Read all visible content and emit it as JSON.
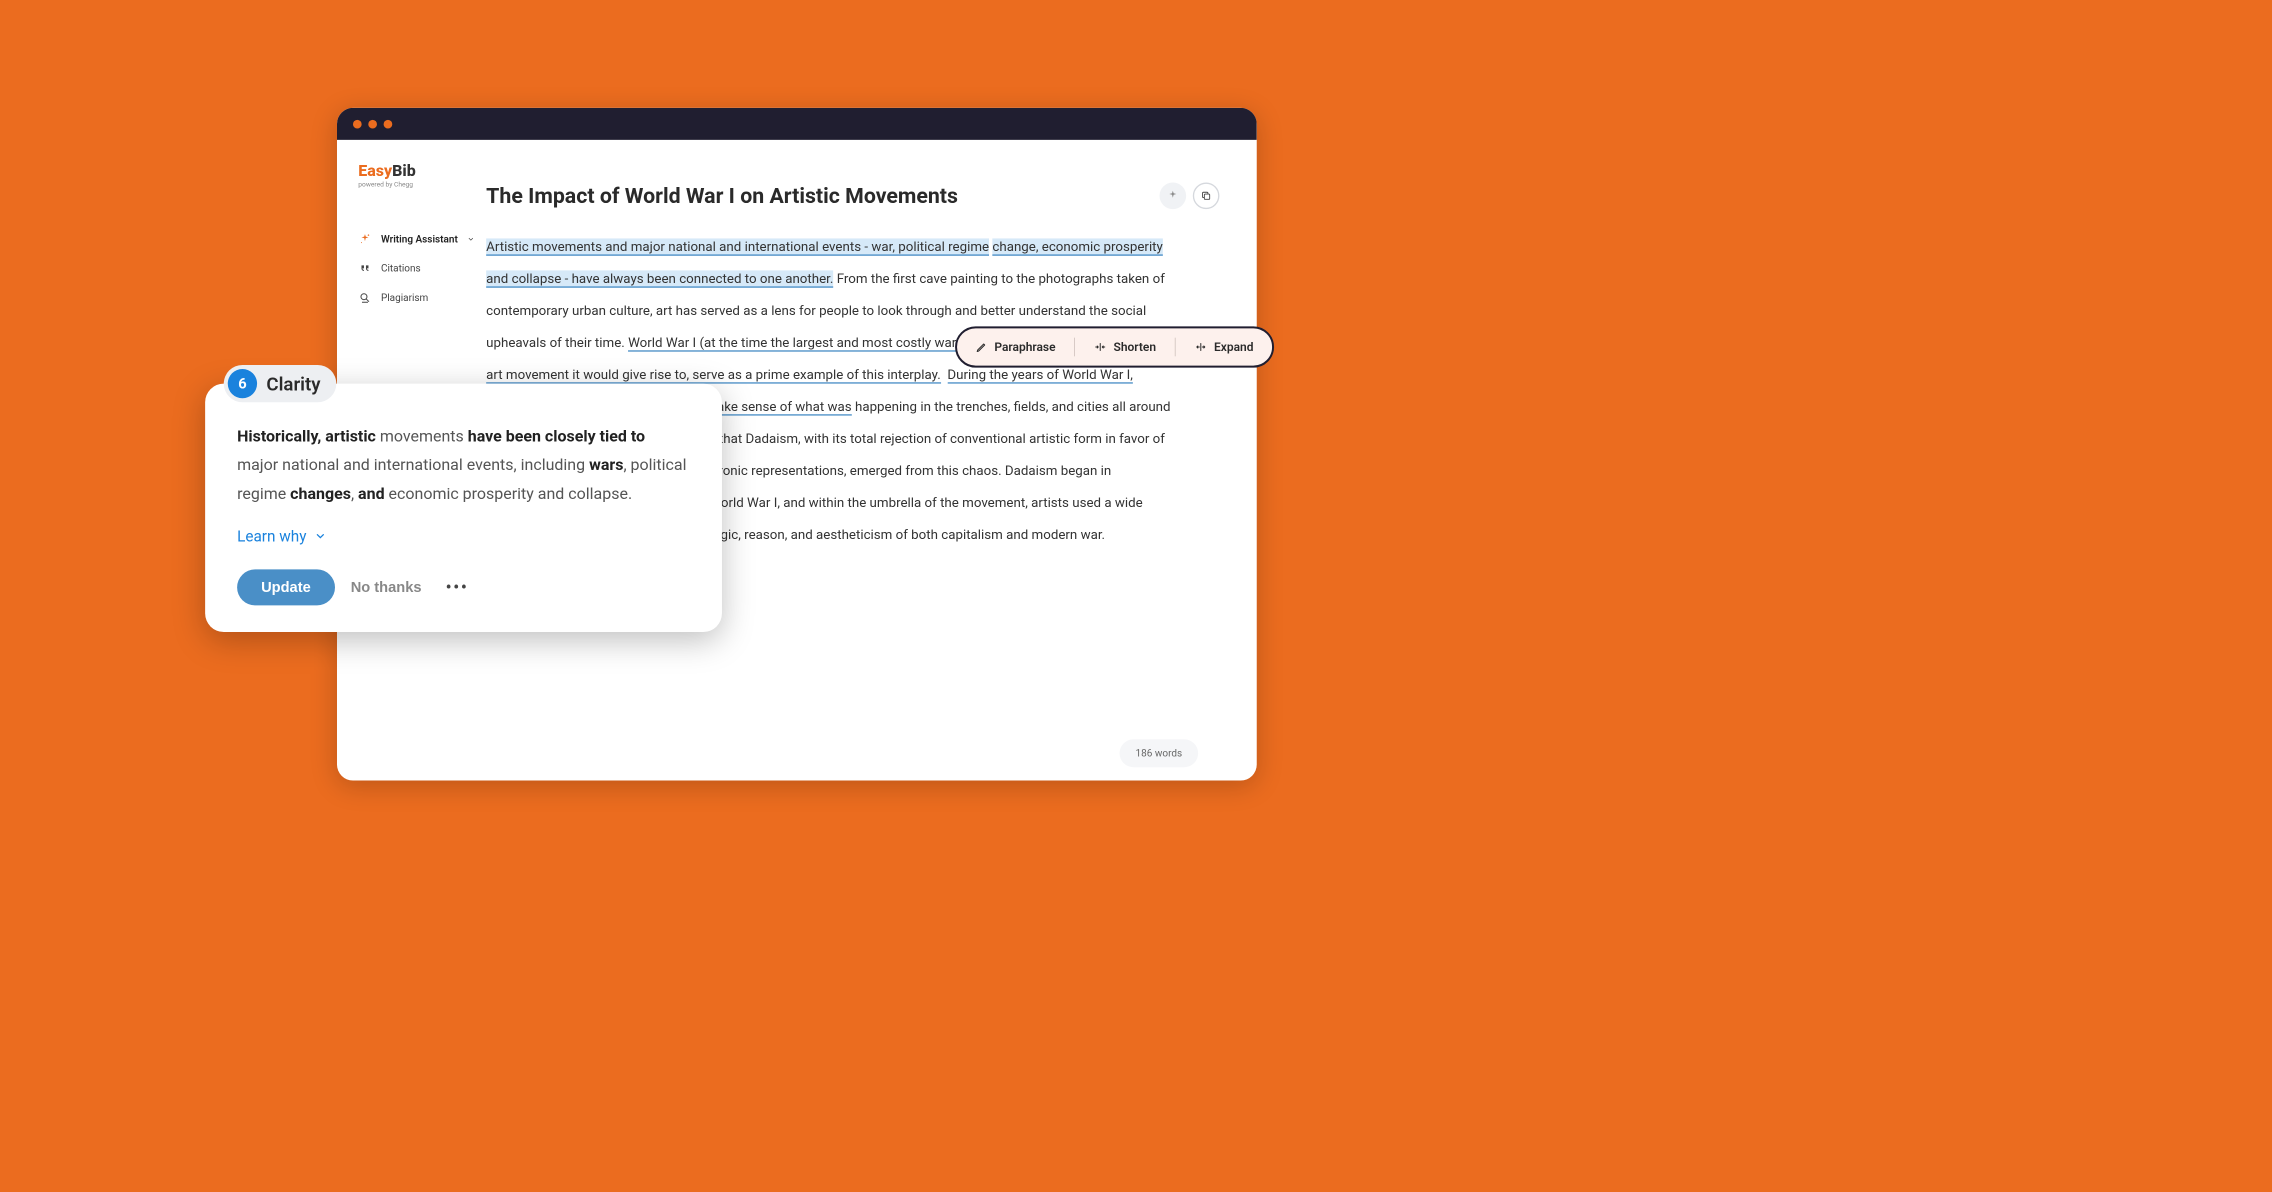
{
  "logo": {
    "part1": "Easy",
    "part2": "Bib",
    "sub": "powered by Chegg"
  },
  "nav": {
    "writing_assistant": "Writing Assistant",
    "citations": "Citations",
    "plagiarism": "Plagiarism"
  },
  "doc": {
    "title": "The Impact of World War I on Artistic Movements",
    "body_hl1": "Artistic movements and major national and international events - war, political regime",
    "body_hl1b": "change, economic prosperity and collapse - have always been connected to one another.",
    "body_p1": " From the first cave painting to the photographs taken of contemporary urban culture, art has served as a lens for people to look through and better understand the social upheavals of their time. ",
    "body_hl2a": "World War I (at the time the largest and most costly war in human history) and Dadaism, the art movement it would give rise to, serve as a prime example of this interplay.",
    "body_hl2b": "During the years of World War I, ordinary observers would struggle to make sense of what was",
    "body_p2": "happening in the trenches, fields, and cities all around them. It is perhaps not surprising, then, that Dadaism, with its total rejection of conventional artistic form in favor of spontaneous, absurd and often deeply ironic representations, emerged from this chaos.  Dadaism began in Switzerland following the outbreak of World War I, and within the umbrella of the movement, artists used a wide variety of artistic forms to protest the logic, reason, and aestheticism of both capitalism and modern war.",
    "word_count": "186 words"
  },
  "popover": {
    "badge_num": "6",
    "badge_label": "Clarity",
    "text_b1": "Historically, artistic",
    "text_1": " movements ",
    "text_b2": "have been closely tied to",
    "text_2": " major national and international events, including ",
    "text_b3": "wars",
    "text_3": ", political regime ",
    "text_b4": "changes",
    "text_4": ", ",
    "text_b5": "and",
    "text_5": " economic prosperity and collapse.",
    "learn_why": "Learn why",
    "update": "Update",
    "no_thanks": "No thanks"
  },
  "toolbar": {
    "paraphrase": "Paraphrase",
    "shorten": "Shorten",
    "expand": "Expand"
  }
}
